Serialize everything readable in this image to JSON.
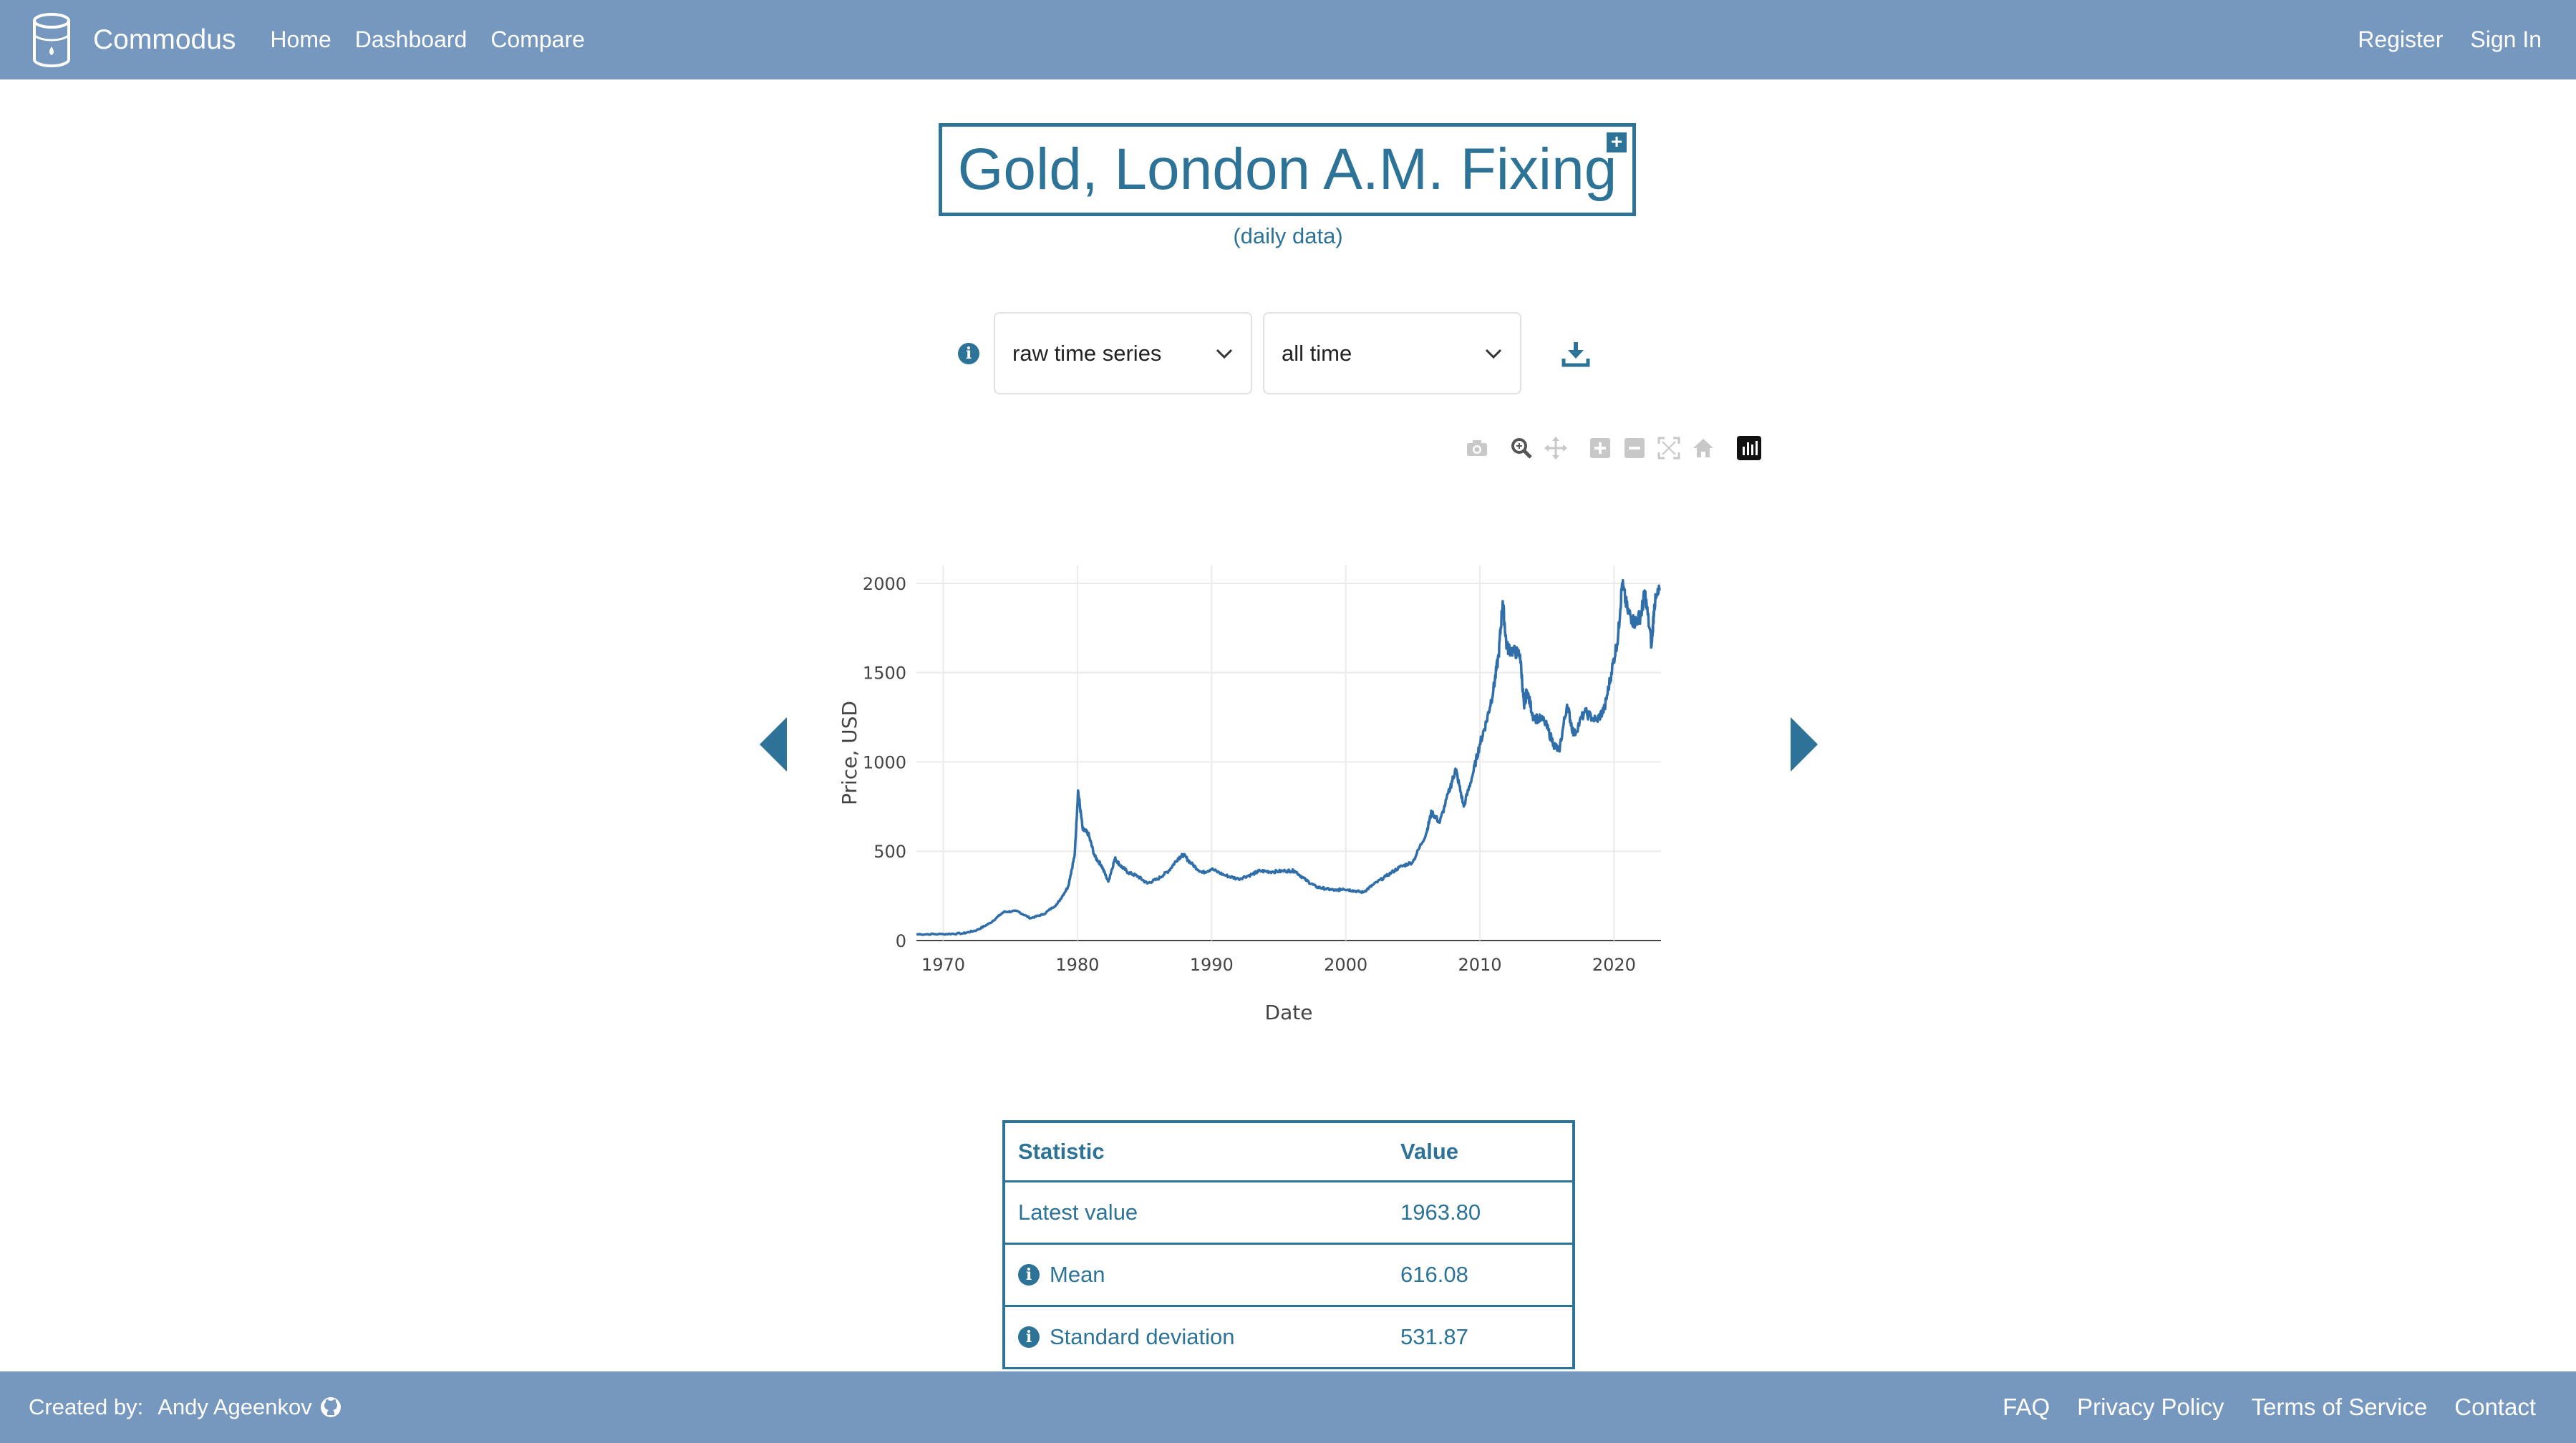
{
  "nav": {
    "brand": "Commodus",
    "links": [
      "Home",
      "Dashboard",
      "Compare"
    ],
    "register": "Register",
    "sign_in": "Sign In"
  },
  "title": {
    "main": "Gold, London A.M. Fixing",
    "add_symbol": "+",
    "subtitle": "(daily data)"
  },
  "controls": {
    "info_symbol": "i",
    "transform_value": "raw time series",
    "range_value": "all time"
  },
  "modebar_icons": [
    "camera-icon",
    "zoom-icon",
    "pan-icon",
    "zoom-in-icon",
    "zoom-out-icon",
    "autoscale-icon",
    "reset-axes-icon",
    "plotly-logo-icon"
  ],
  "chart_data": {
    "type": "line",
    "xlabel": "Date",
    "ylabel": "Price, USD",
    "xlim": [
      1968,
      2023.5
    ],
    "ylim": [
      0,
      2100
    ],
    "x_ticks": [
      1970,
      1980,
      1990,
      2000,
      2010,
      2020
    ],
    "y_ticks": [
      0,
      500,
      1000,
      1500,
      2000
    ],
    "x_tick_labels": [
      "1970",
      "1980",
      "1990",
      "2000",
      "2010",
      "2020"
    ],
    "y_tick_labels": [
      "0",
      "500",
      "1000",
      "1500",
      "2000"
    ],
    "grid": true,
    "color": "#2f6ea8",
    "series": [
      {
        "x": [
          1968.0,
          1970.0,
          1971.5,
          1972.5,
          1973.5,
          1974.5,
          1975.5,
          1976.5,
          1977.5,
          1978.5,
          1979.3,
          1979.8,
          1980.05,
          1980.4,
          1980.8,
          1981.3,
          1981.8,
          1982.3,
          1982.8,
          1983.2,
          1983.8,
          1984.5,
          1985.2,
          1986.0,
          1986.8,
          1987.5,
          1987.9,
          1988.5,
          1989.3,
          1990.0,
          1991.0,
          1992.0,
          1993.0,
          1993.6,
          1994.5,
          1995.5,
          1996.2,
          1997.0,
          1997.8,
          1998.5,
          1999.3,
          1999.8,
          2000.5,
          2001.3,
          2002.0,
          2003.0,
          2004.0,
          2005.0,
          2006.0,
          2006.4,
          2007.0,
          2007.8,
          2008.2,
          2008.8,
          2009.5,
          2010.0,
          2010.5,
          2011.0,
          2011.4,
          2011.7,
          2012.0,
          2012.5,
          2013.0,
          2013.3,
          2013.5,
          2014.0,
          2014.8,
          2015.5,
          2015.9,
          2016.5,
          2017.0,
          2017.8,
          2018.7,
          2019.3,
          2019.8,
          2020.3,
          2020.6,
          2021.0,
          2021.5,
          2022.0,
          2022.3,
          2022.8,
          2023.0,
          2023.4
        ],
        "y": [
          35,
          36,
          40,
          58,
          98,
          160,
          165,
          125,
          148,
          205,
          300,
          480,
          840,
          620,
          600,
          470,
          420,
          330,
          460,
          420,
          380,
          360,
          320,
          345,
          390,
          460,
          480,
          430,
          380,
          400,
          365,
          345,
          370,
          390,
          385,
          390,
          390,
          340,
          300,
          290,
          280,
          290,
          280,
          270,
          310,
          360,
          410,
          440,
          600,
          720,
          660,
          860,
          960,
          750,
          940,
          1100,
          1230,
          1400,
          1600,
          1900,
          1640,
          1620,
          1600,
          1300,
          1400,
          1250,
          1230,
          1100,
          1060,
          1320,
          1150,
          1280,
          1230,
          1300,
          1500,
          1700,
          2000,
          1850,
          1780,
          1820,
          1950,
          1650,
          1880,
          1960
        ]
      }
    ]
  },
  "stats": {
    "header_statistic": "Statistic",
    "header_value": "Value",
    "rows": [
      {
        "label": "Latest value",
        "value": "1963.80",
        "info": false
      },
      {
        "label": "Mean",
        "value": "616.08",
        "info": true
      },
      {
        "label": "Standard deviation",
        "value": "531.87",
        "info": true
      }
    ]
  },
  "footer": {
    "created_by": "Created by:",
    "author": "Andy Ageenkov",
    "links": [
      "FAQ",
      "Privacy Policy",
      "Terms of Service",
      "Contact"
    ]
  }
}
